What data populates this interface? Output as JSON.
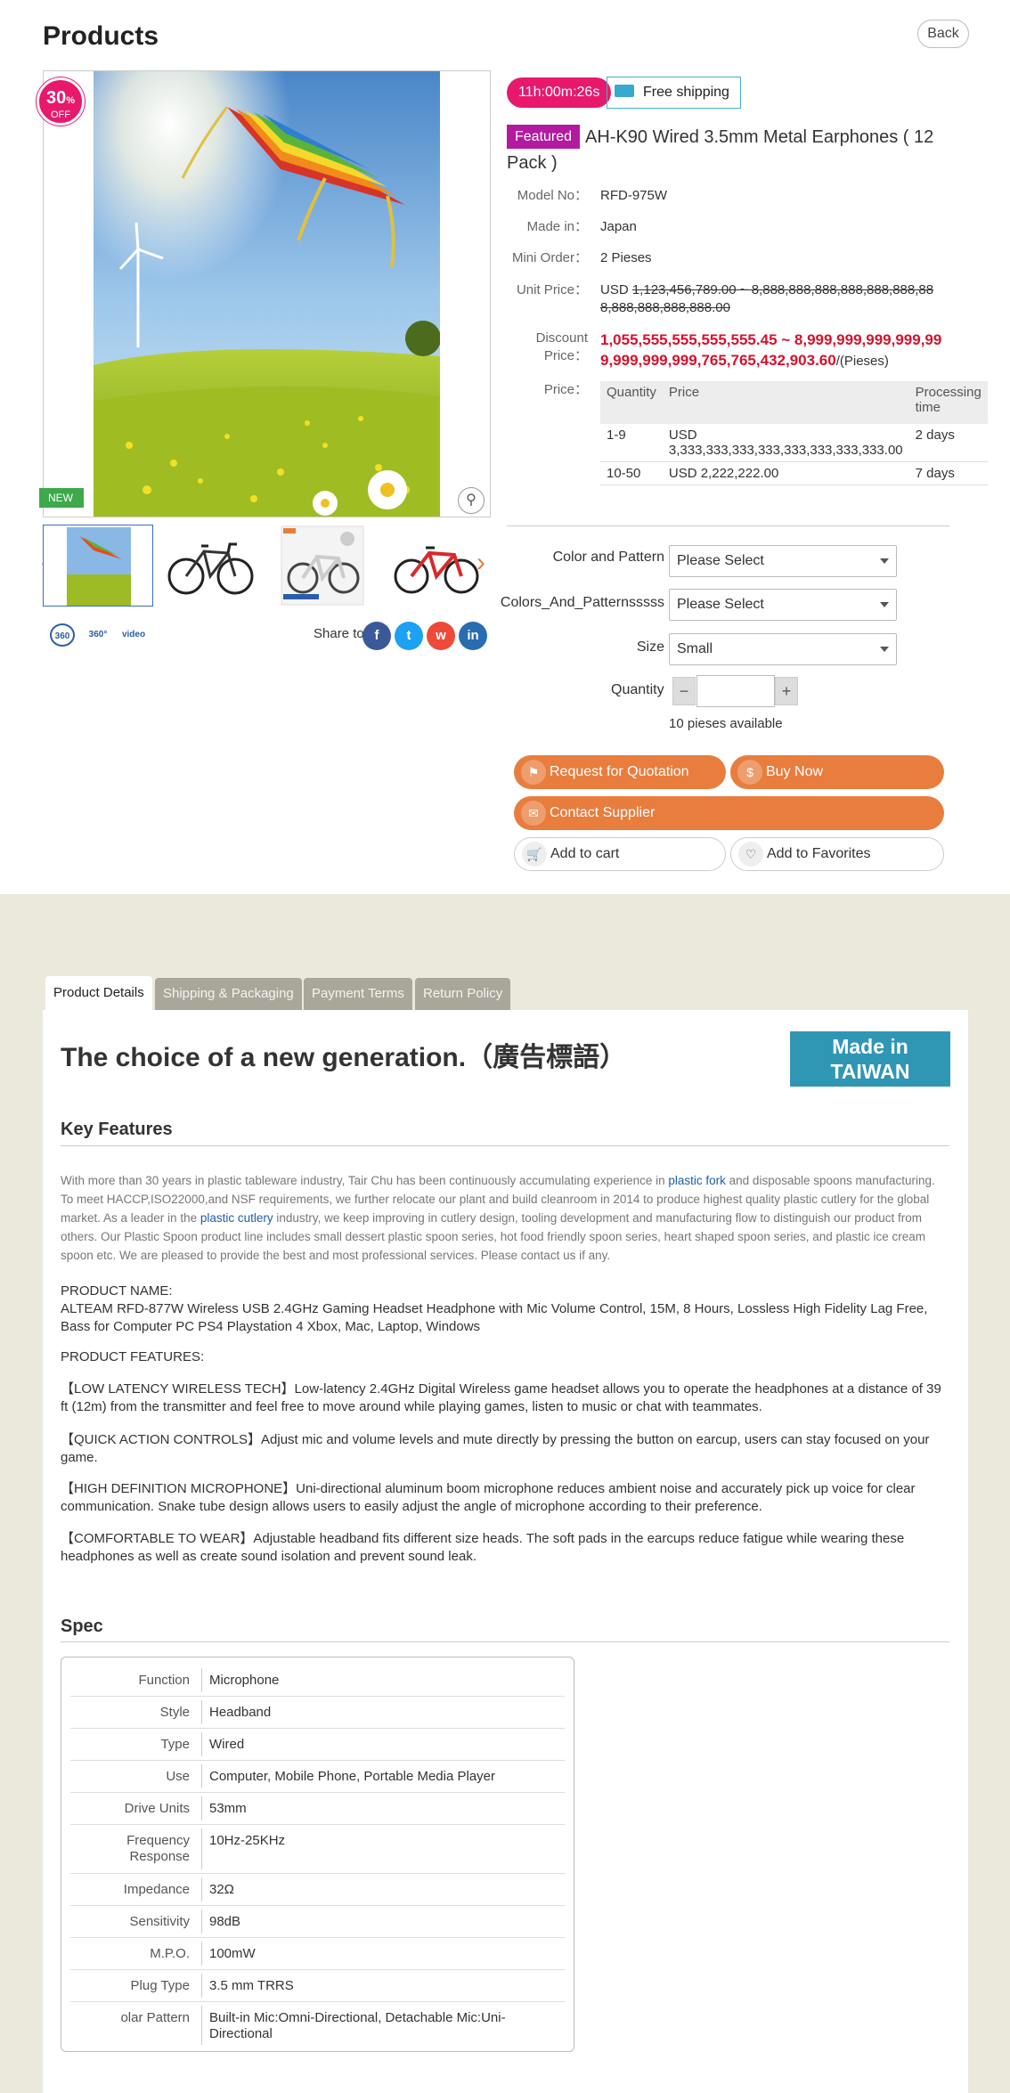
{
  "page": {
    "title": "Products",
    "back_label": "Back"
  },
  "gallery": {
    "discount_percent": "30",
    "discount_unit": "%",
    "discount_off": "OFF",
    "new_tag": "NEW",
    "media_icons": [
      "360",
      "360°",
      "video"
    ],
    "share_label": "Share to",
    "share_buttons": [
      "f",
      "t",
      "w",
      "in"
    ]
  },
  "product": {
    "timer": "11h:00m:26s",
    "shipping": "Free shipping",
    "featured_label": "Featured",
    "title": "AH-K90 Wired 3.5mm Metal Earphones ( 12 Pack )",
    "fields": {
      "model_label": "Model No：",
      "model_value": "RFD-975W",
      "made_label": "Made in：",
      "made_value": "Japan",
      "min_label": "Mini Order：",
      "min_value": "2 Pieses",
      "unit_label": "Unit Price：",
      "unit_currency": "USD",
      "unit_value": "1,123,456,789.00 ~ 8,888,888,888,888,888,888,888,888,888,888,888.00",
      "discount_label": "Discount Price：",
      "discount_value": "1,055,555,555,555,555.45 ~ 8,999,999,999,999,999,999,999,999,765,765,432,903.60",
      "discount_unit": "/(Pieses)",
      "price_label": "Price："
    },
    "price_table": {
      "headers": [
        "Quantity",
        "Price",
        "Processing time"
      ],
      "rows": [
        [
          "1-9",
          "USD 3,333,333,333,333,333,333,333,333.00",
          "2 days"
        ],
        [
          "10-50",
          "USD 2,222,222.00",
          "7 days"
        ]
      ]
    },
    "options": [
      {
        "label": "Color and Pattern",
        "value": "Please Select"
      },
      {
        "label": "Colors_And_Patternsssss",
        "value": "Please Select"
      },
      {
        "label": "Size",
        "value": "Small"
      }
    ],
    "quantity_label": "Quantity",
    "qty_minus": "−",
    "qty_plus": "+",
    "available": "10 pieses available",
    "actions": {
      "quote": "Request for Quotation",
      "buy": "Buy Now",
      "contact": "Contact Supplier",
      "cart": "Add to cart",
      "favorites": "Add to Favorites"
    },
    "accent_color": "#e87d3e",
    "timer_color": "#e8196c"
  },
  "details": {
    "tabs": [
      "Product Details",
      "Shipping & Packaging",
      "Payment Terms",
      "Return Policy"
    ],
    "slogan": "The choice of a new generation.（廣告標語）",
    "badge_line1": "Made in",
    "badge_line2": "TAIWAN",
    "key_features_heading": "Key Features",
    "kf_p1": "With more than 30 years in plastic tableware industry, Tair Chu has been continuously accumulating experience in ",
    "kf_link1": "plastic fork",
    "kf_p2": "  and disposable spoons manufacturing. To meet HACCP,ISO22000,and NSF requirements, we further relocate our plant and  build cleanroom in 2014 to produce highest quality plastic cutlery for the global market. As a leader in the ",
    "kf_link2": "plastic cutlery",
    "kf_p3": " industry, we keep improving in cutlery design, tooling development and manufacturing flow to distinguish our product from others. Our Plastic Spoon product line includes small dessert plastic spoon series, hot food friendly spoon series, heart shaped spoon series, and plastic ice cream spoon etc. We are pleased to provide the best and most professional services. Please contact us if any.",
    "product_name_label": "PRODUCT NAME:",
    "product_name": "ALTEAM RFD-877W Wireless USB 2.4GHz Gaming Headset Headphone with Mic Volume Control, 15M, 8 Hours, Lossless High Fidelity Lag Free, Bass for Computer PC PS4 Playstation 4 Xbox, Mac, Laptop, Windows",
    "features_label": "PRODUCT FEATURES:",
    "feature1": "【LOW LATENCY WIRELESS TECH】Low-latency 2.4GHz Digital Wireless game headset allows you to operate the headphones at a distance of 39 ft (12m) from the transmitter and feel free to move around while playing games, listen to music or chat with teammates.",
    "feature2": "【QUICK ACTION CONTROLS】Adjust mic and volume levels and mute directly by pressing the button on earcup, users can stay focused on your game.",
    "feature3": "【HIGH DEFINITION MICROPHONE】Uni-directional aluminum boom microphone reduces ambient noise and accurately pick up voice for clear communication. Snake tube design allows users to easily adjust the angle of microphone according to their preference.",
    "feature4": "【COMFORTABLE TO WEAR】Adjustable headband fits different size heads. The soft pads in the earcups reduce fatigue while wearing these headphones as well as create sound isolation and prevent sound leak.",
    "spec_heading": "Spec",
    "spec": [
      [
        "Function",
        "Microphone"
      ],
      [
        "Style",
        "Headband"
      ],
      [
        "Type",
        "Wired"
      ],
      [
        "Use",
        "Computer, Mobile Phone, Portable Media Player"
      ],
      [
        "Drive Units",
        "53mm"
      ],
      [
        "Frequency Response",
        "10Hz-25KHz"
      ],
      [
        "Impedance",
        "32Ω"
      ],
      [
        "Sensitivity",
        "98dB"
      ],
      [
        "M.P.O.",
        "100mW"
      ],
      [
        "Plug Type",
        "3.5 mm TRRS"
      ],
      [
        "olar Pattern",
        "Built-in Mic:Omni-Directional, Detachable Mic:Uni-Directional"
      ]
    ]
  }
}
